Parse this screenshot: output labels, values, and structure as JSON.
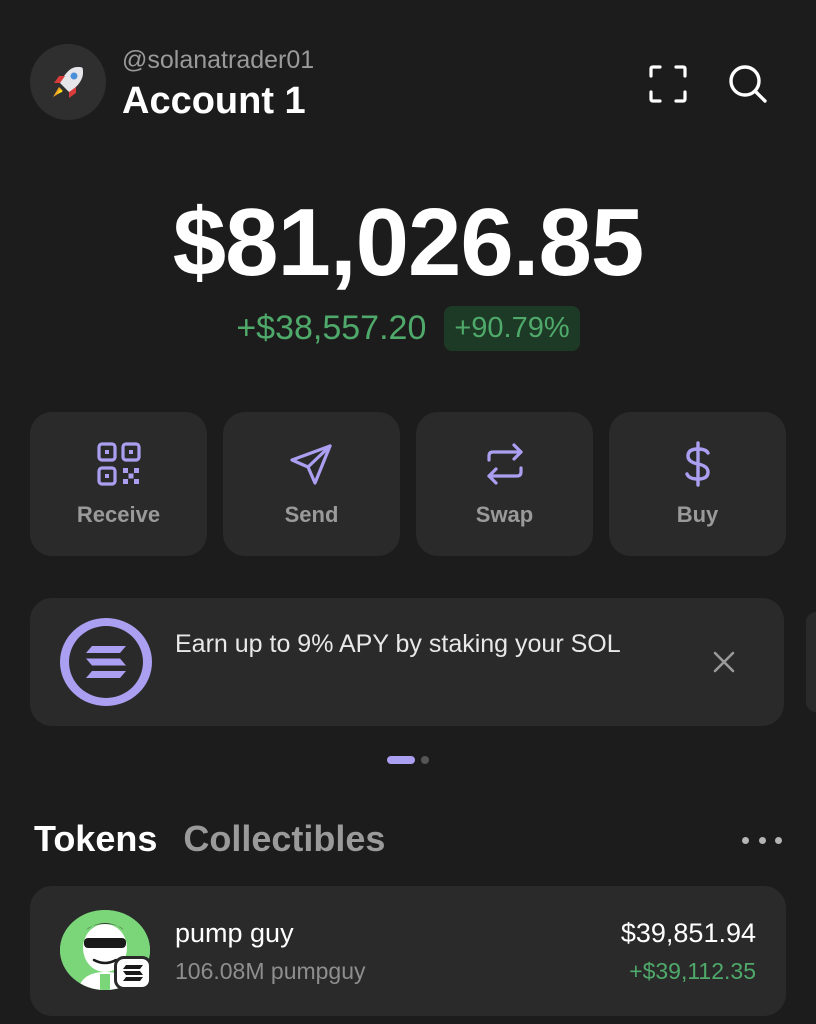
{
  "header": {
    "username": "@solanatrader01",
    "account_name": "Account 1",
    "icons": [
      "rocket-icon",
      "expand-icon",
      "search-icon"
    ]
  },
  "balance": {
    "total": "$81,026.85",
    "change_amount": "+$38,557.20",
    "change_percent": "+90.79%"
  },
  "actions": [
    {
      "label": "Receive",
      "icon": "qr-code-icon"
    },
    {
      "label": "Send",
      "icon": "send-icon"
    },
    {
      "label": "Swap",
      "icon": "swap-icon"
    },
    {
      "label": "Buy",
      "icon": "dollar-icon"
    }
  ],
  "banner": {
    "text": "Earn up to 9% APY by staking your SOL",
    "icon": "solana-logo-icon"
  },
  "pager": {
    "total": 2,
    "active": 1
  },
  "tabs": [
    {
      "label": "Tokens",
      "active": true
    },
    {
      "label": "Collectibles",
      "active": false
    }
  ],
  "tokens": [
    {
      "name": "pump guy",
      "quantity": "106.08M pumpguy",
      "value": "$39,851.94",
      "change": "+$39,112.35"
    }
  ],
  "colors": {
    "background": "#1c1c1c",
    "card": "#2a2a2a",
    "accent": "#ab9ff2",
    "positive": "#4fa96a",
    "muted_text": "#9a9a9a"
  }
}
